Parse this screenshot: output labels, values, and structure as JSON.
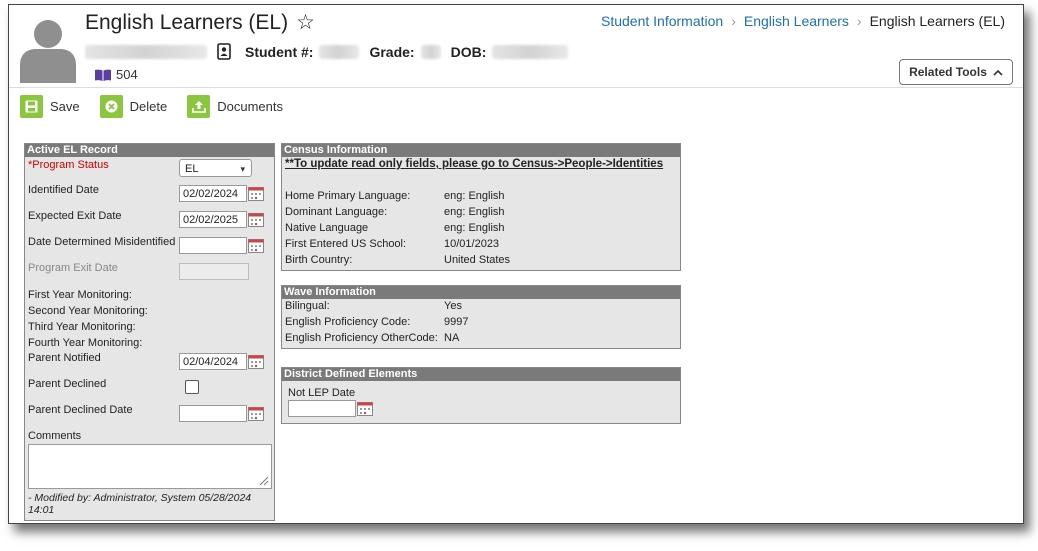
{
  "header": {
    "title": "English Learners (EL)",
    "breadcrumb": [
      "Student Information",
      "English Learners",
      "English Learners (EL)"
    ],
    "student_label": "Student #:",
    "grade_label": "Grade:",
    "dob_label": "DOB:",
    "badge_504": "504",
    "related_tools": "Related Tools"
  },
  "toolbar": {
    "save": "Save",
    "delete": "Delete",
    "documents": "Documents"
  },
  "active_el": {
    "heading": "Active EL Record",
    "program_status_label": "*Program Status",
    "program_status_value": "EL",
    "identified_date_label": "Identified Date",
    "identified_date": "02/02/2024",
    "expected_exit_label": "Expected Exit Date",
    "expected_exit": "02/02/2025",
    "misidentified_label": "Date Determined Misidentified",
    "program_exit_label": "Program Exit Date",
    "first_year": "First Year Monitoring:",
    "second_year": "Second Year Monitoring:",
    "third_year": "Third Year Monitoring:",
    "fourth_year": "Fourth Year Monitoring:",
    "parent_notified_label": "Parent Notified",
    "parent_notified": "02/04/2024",
    "parent_declined_label": "Parent Declined",
    "parent_declined_date_label": "Parent Declined Date",
    "comments_label": "Comments",
    "modified_by": "- Modified by: Administrator, System 05/28/2024 14:01"
  },
  "census": {
    "heading": "Census Information",
    "notice": "**To update read only fields, please go to Census->People->Identities",
    "rows": [
      {
        "label": "Home Primary Language:",
        "value": "eng: English"
      },
      {
        "label": "Dominant Language:",
        "value": "eng: English"
      },
      {
        "label": "Native Language",
        "value": "eng: English"
      },
      {
        "label": "First Entered US School:",
        "value": "10/01/2023"
      },
      {
        "label": "Birth Country:",
        "value": "United States"
      }
    ]
  },
  "wave": {
    "heading": "Wave Information",
    "rows": [
      {
        "label": "Bilingual:",
        "value": "Yes"
      },
      {
        "label": "English Proficiency Code:",
        "value": "9997"
      },
      {
        "label": "English Proficiency OtherCode:",
        "value": "NA"
      }
    ]
  },
  "district": {
    "heading": "District Defined Elements",
    "not_lep_label": "Not LEP Date"
  },
  "colors": {
    "accent_green": "#8cc63f",
    "link_blue": "#1f6fb2",
    "panel_header": "#7a7a7a",
    "panel_bg": "#e6e6e6"
  }
}
